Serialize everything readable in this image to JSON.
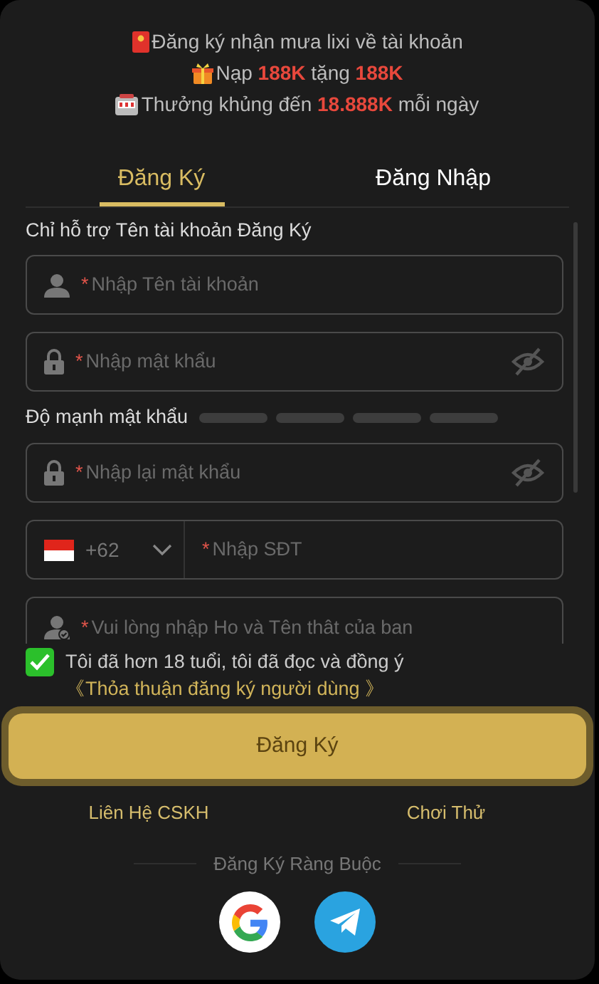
{
  "promo": [
    {
      "kind": "envelope",
      "text": "Đăng ký nhận mưa lixi về tài khoản"
    },
    {
      "kind": "gift",
      "text": "Nạp **188K** tặng **188K**"
    },
    {
      "kind": "slot",
      "text": "Thưởng khủng đến **18.888K** mỗi ngày"
    }
  ],
  "tabs": [
    {
      "label": "Đăng Ký",
      "selected": true
    },
    {
      "label": "Đăng Nhập",
      "selected": false
    }
  ],
  "hint": "Chỉ hỗ trợ Tên tài khoản Đăng Ký",
  "fields": [
    {
      "kind": "user",
      "required_mark": "*",
      "placeholder": "Nhập Tên tài khoản"
    },
    {
      "kind": "password",
      "required_mark": "*",
      "placeholder": "Nhập mật khẩu"
    },
    {
      "kind": "strength",
      "label": "Độ mạnh mật khẩu"
    },
    {
      "kind": "password",
      "required_mark": "*",
      "placeholder": "Nhập lại mật khẩu"
    },
    {
      "kind": "phone",
      "code": "+62",
      "required_mark": "*",
      "placeholder": "Nhập SĐT"
    },
    {
      "kind": "name",
      "required_mark": "*",
      "placeholder": "Vui lòng nhập Ho và Tên thât của ban"
    }
  ],
  "agree": {
    "checked": true,
    "text": "Tôi đã hơn 18 tuổi, tôi đã đọc và đồng ý",
    "link": "《Thỏa thuận đăng ký người dùng 》"
  },
  "submit": "Đăng Ký",
  "links": [
    "Liên Hệ CSKH",
    "Chơi Thử"
  ],
  "bind_label": "Đăng Ký Ràng Buộc",
  "social": [
    {
      "kind": "google"
    },
    {
      "kind": "telegram"
    }
  ]
}
